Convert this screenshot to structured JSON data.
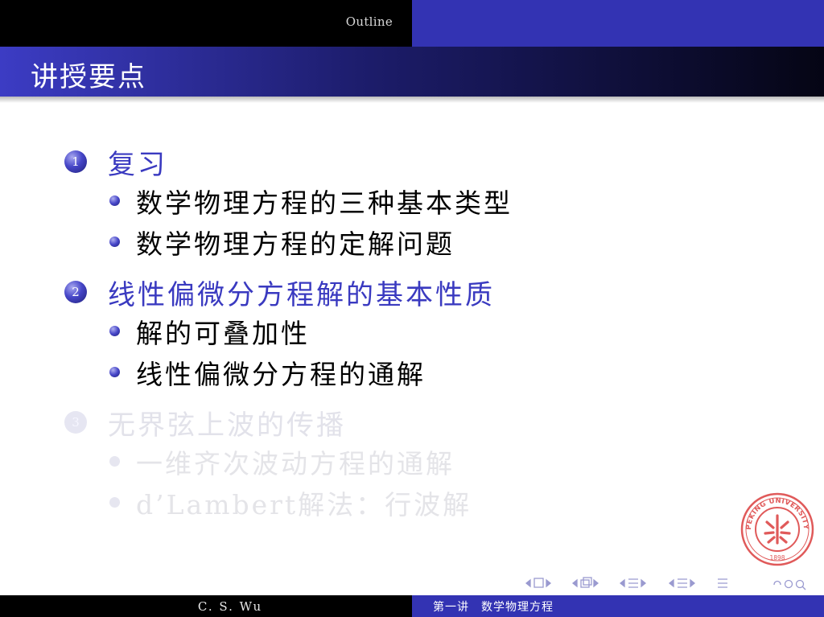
{
  "header": {
    "outline_label": "Outline"
  },
  "frame": {
    "title": "讲授要点"
  },
  "sections": [
    {
      "number": "1",
      "label": "复习",
      "items": [
        "数学物理方程的三种基本类型",
        "数学物理方程的定解问题"
      ]
    },
    {
      "number": "2",
      "label": "线性偏微分方程解的基本性质",
      "items": [
        "解的可叠加性",
        "线性偏微分方程的通解"
      ]
    },
    {
      "number": "3",
      "label": "无界弦上波的传播",
      "items": [
        "一维齐次波动方程的通解",
        "d’Lambert解法：行波解"
      ]
    }
  ],
  "footer": {
    "author": "C. S. Wu",
    "lecture": "第一讲　数学物理方程"
  },
  "seal": {
    "text": "PEKING UNIVERSITY",
    "year": "1898",
    "color": "#e05a5a"
  },
  "colors": {
    "accent": "#3333b3",
    "header_dark": "#000000",
    "section_active": "#3a3ac0",
    "section_faded": "#e2e2ea"
  }
}
